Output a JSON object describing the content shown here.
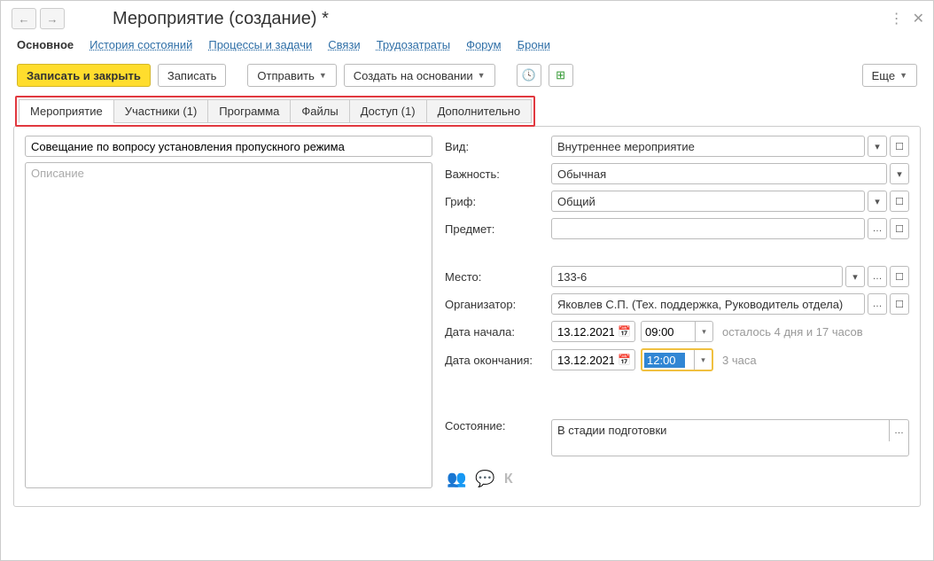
{
  "window": {
    "title": "Мероприятие (создание) *"
  },
  "nav": {
    "main": "Основное",
    "history": "История состояний",
    "processes": "Процессы и задачи",
    "links": "Связи",
    "labor": "Трудозатраты",
    "forum": "Форум",
    "booking": "Брони"
  },
  "toolbar": {
    "save_close": "Записать и закрыть",
    "save": "Записать",
    "send": "Отправить",
    "create_based": "Создать на основании",
    "more": "Еще"
  },
  "content_tabs": {
    "event": "Мероприятие",
    "participants": "Участники (1)",
    "program": "Программа",
    "files": "Файлы",
    "access": "Доступ (1)",
    "extra": "Дополнительно"
  },
  "form": {
    "subject_value": "Совещание по вопросу установления пропускного режима",
    "description_placeholder": "Описание",
    "labels": {
      "kind": "Вид:",
      "importance": "Важность:",
      "grif": "Гриф:",
      "subject": "Предмет:",
      "place": "Место:",
      "organizer": "Организатор:",
      "date_start": "Дата начала:",
      "date_end": "Дата окончания:",
      "state": "Состояние:"
    },
    "values": {
      "kind": "Внутреннее мероприятие",
      "importance": "Обычная",
      "grif": "Общий",
      "subject": "",
      "place": "133-6",
      "organizer": "Яковлев С.П. (Тех. поддержка, Руководитель отдела)",
      "date_start": "13.12.2021",
      "time_start": "09:00",
      "date_end": "13.12.2021",
      "time_end": "12:00",
      "state": "В стадии подготовки"
    },
    "hints": {
      "remain": "осталось 4 дня и 17 часов",
      "duration": "3 часа"
    }
  },
  "footer_k": "К"
}
